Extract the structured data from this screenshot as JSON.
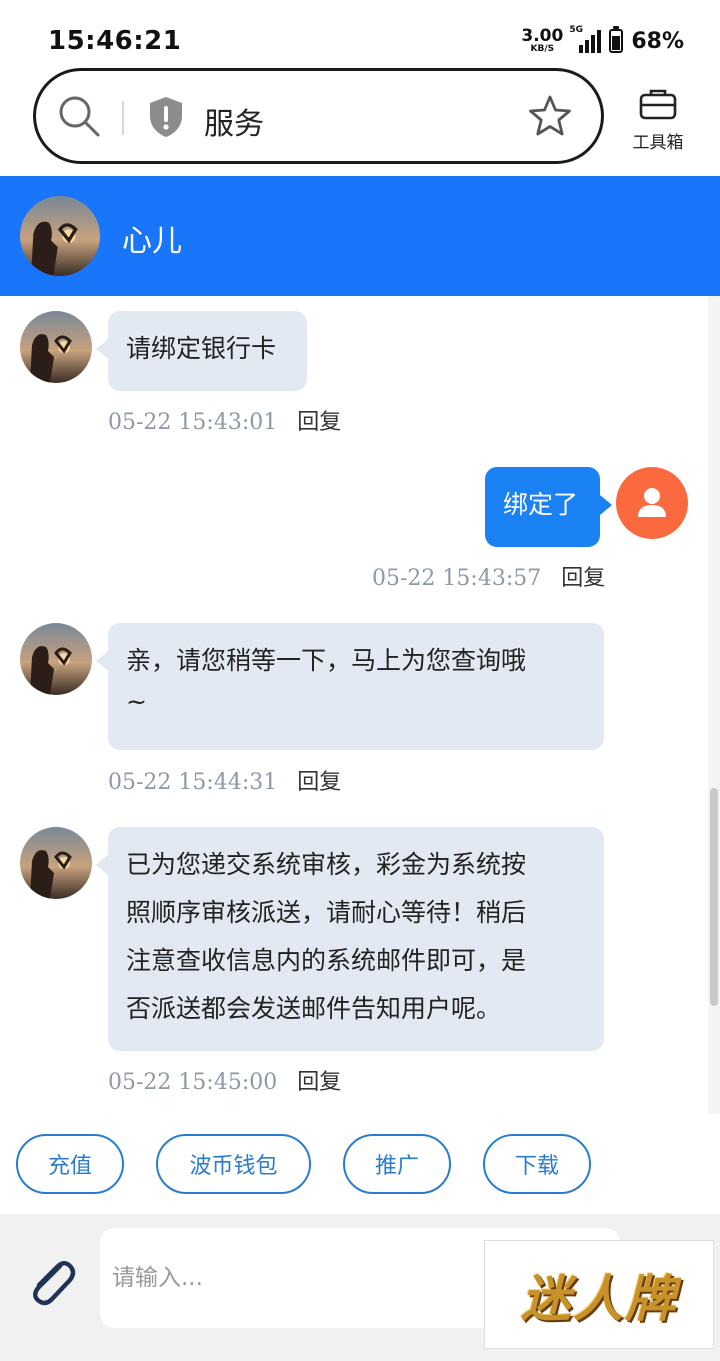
{
  "status_bar": {
    "time": "15:46:21",
    "net_speed_value": "3.00",
    "net_speed_unit": "KB/S",
    "network_type": "5G",
    "battery_percent": "68%",
    "battery_level": 0.68
  },
  "address_bar": {
    "title": "服务",
    "toolbox_label": "工具箱"
  },
  "chat_header": {
    "contact_name": "心儿"
  },
  "messages": [
    {
      "side": "left",
      "text": "请绑定银行卡",
      "time": "05-22 15:43:01",
      "reply": "回复"
    },
    {
      "side": "right",
      "text": "绑定了",
      "time": "05-22 15:43:57",
      "reply": "回复"
    },
    {
      "side": "left",
      "text": "亲，请您稍等一下，马上为您查询哦~",
      "line1": "亲，请您稍等一下，马上为您查询哦",
      "line2": "~",
      "time": "05-22 15:44:31",
      "reply": "回复"
    },
    {
      "side": "left",
      "line1": "已为您递交系统审核，彩金为系统按",
      "line2": "照顺序审核派送，请耐心等待！稍后",
      "line3": "注意查收信息内的系统邮件即可，是",
      "line4": "否派送都会发送邮件告知用户呢。",
      "time": "05-22 15:45:00",
      "reply": "回复"
    }
  ],
  "quick_actions": [
    "充值",
    "波币钱包",
    "推广",
    "下载"
  ],
  "input_bar": {
    "placeholder": "请输入..."
  },
  "watermark": "迷人牌",
  "colors": {
    "header_blue": "#1976fb",
    "outgoing_bubble": "#1a82f5",
    "incoming_bubble": "#e3e9f3",
    "user_avatar": "#fb6a3e",
    "quick_action_border": "#2a7ccd"
  }
}
